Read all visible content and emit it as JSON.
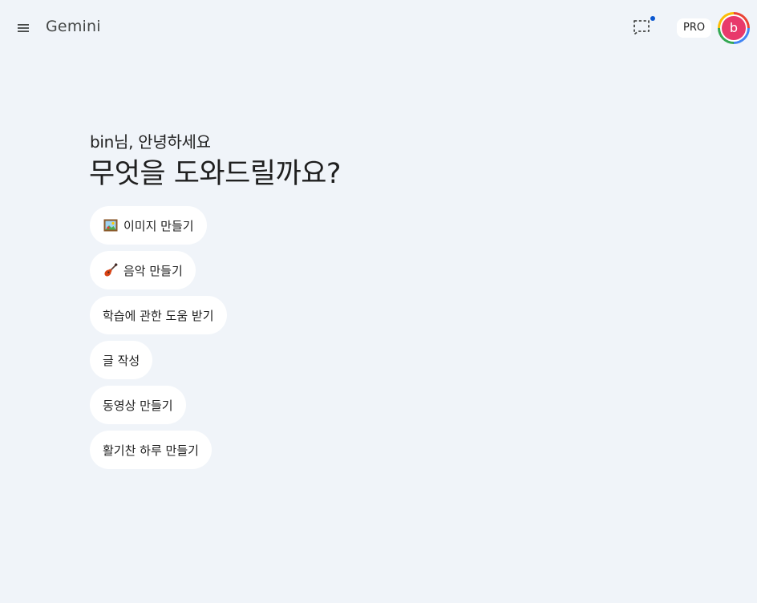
{
  "header": {
    "app_title": "Gemini",
    "pro_label": "PRO",
    "avatar_initial": "b",
    "menu_icon": "hamburger-menu-icon",
    "feedback_icon": "feedback-dashed-square-icon",
    "colors": {
      "background": "#f0f4f9",
      "notification_dot": "#0b57d0",
      "avatar_bg": "#e8396b"
    }
  },
  "main": {
    "greeting": "bin님, 안녕하세요",
    "headline": "무엇을 도와드릴까요?",
    "chips": [
      {
        "label": "이미지 만들기",
        "icon": "framed-picture-icon"
      },
      {
        "label": "음악 만들기",
        "icon": "guitar-icon"
      },
      {
        "label": "학습에 관한 도움 받기",
        "icon": ""
      },
      {
        "label": "글 작성",
        "icon": ""
      },
      {
        "label": "동영상 만들기",
        "icon": ""
      },
      {
        "label": "활기찬 하루 만들기",
        "icon": ""
      }
    ]
  }
}
